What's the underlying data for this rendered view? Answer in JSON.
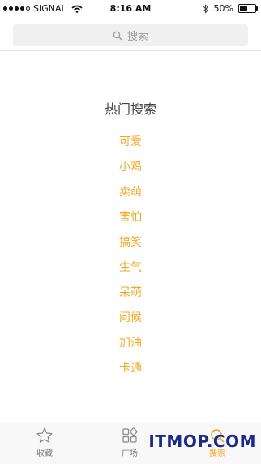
{
  "status_bar": {
    "carrier": "SIGNAL",
    "time": "8:16 AM",
    "battery": "50%",
    "battery_level": 0.5,
    "icons": [
      "signal-dots-icon",
      "wifi-icon",
      "bluetooth-icon",
      "battery-icon"
    ]
  },
  "search": {
    "placeholder": "搜索",
    "icon": "search-icon"
  },
  "hot": {
    "title": "热门搜索",
    "items": [
      "可爱",
      "小鸡",
      "卖萌",
      "害怕",
      "搞笑",
      "生气",
      "呆萌",
      "问候",
      "加油",
      "卡通"
    ]
  },
  "tabbar": {
    "tabs": [
      {
        "label": "收藏",
        "icon": "star-icon"
      },
      {
        "label": "广场",
        "icon": "grid-icon"
      },
      {
        "label": "搜索",
        "icon": "search-icon",
        "active": true
      }
    ]
  },
  "colors": {
    "accent": "#f2a825",
    "watermark": "#1a2a8a"
  },
  "watermark": "ITMOP.COM"
}
